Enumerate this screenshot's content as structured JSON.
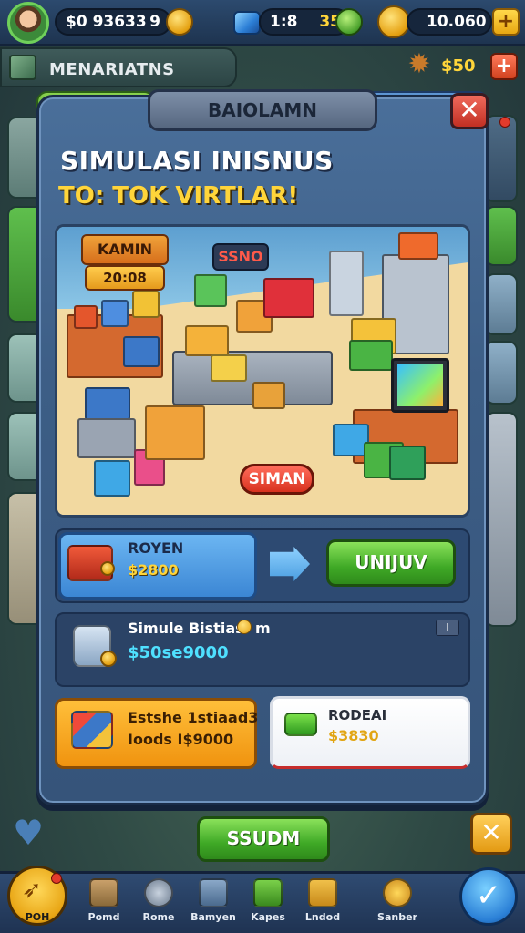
{
  "topbar": {
    "coins": "$0 93633",
    "coins_level": "9",
    "gems": "1:8",
    "gems_level": "35",
    "gold": "10.060",
    "plus": "+"
  },
  "menu": {
    "label": "MENARIATNS",
    "right_value": "$50",
    "right_plus": "+"
  },
  "modal": {
    "title": "BAIOLAMN",
    "close": "✕",
    "headline": "SIMULASI INISNUS",
    "subline": "TO: TOK VIRTLAR!",
    "scene": {
      "sign1": "KAMIN",
      "sign2": "20:08",
      "sign3": "SSNO",
      "tag": "SIMAN"
    },
    "offer": {
      "title": "ROYEN",
      "price": "$2800",
      "buy_label": "UNIJUV"
    },
    "info": {
      "title": "Simule Bistiasi",
      "suffix": "m",
      "value": "$50se9000",
      "badge": "I"
    },
    "card_orange": {
      "line1": "Estshe 1stiaad3",
      "line2": "Ioods I$9000"
    },
    "card_white": {
      "title": "RODEAI",
      "price": "$3830"
    }
  },
  "footer": {
    "confirm_label": "SSUDM",
    "cancel_label": "✕"
  },
  "nav": {
    "home_label": "POH",
    "items": [
      {
        "label": "Pomd"
      },
      {
        "label": "Rome"
      },
      {
        "label": "Bamyen"
      },
      {
        "label": "Kapes"
      },
      {
        "label": "Lndod"
      },
      {
        "label": "Sanber"
      }
    ],
    "ok_label": "✓"
  },
  "colors": {
    "modal_bg": "#3d5e86",
    "accent_green": "#3fa926",
    "accent_yellow": "#ffd53a",
    "close_red": "#c22f23"
  }
}
